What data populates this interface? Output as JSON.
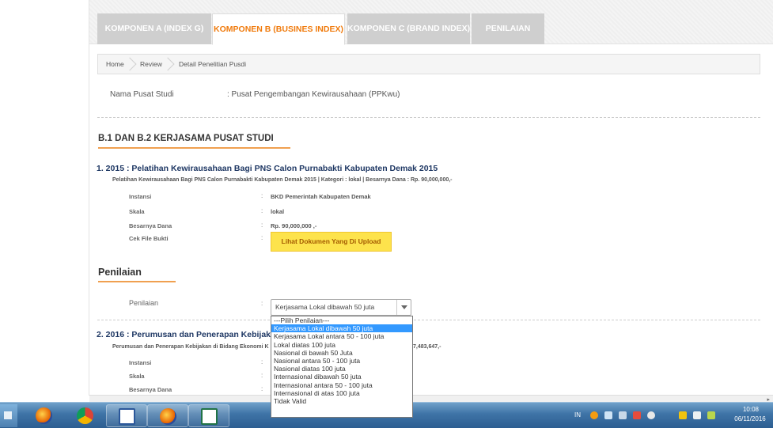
{
  "tabs": [
    {
      "label": "KOMPONEN A (INDEX G)",
      "active": false
    },
    {
      "label": "KOMPONEN B (BUSINES INDEX)",
      "active": true
    },
    {
      "label": "KOMPONEN C (BRAND INDEX)",
      "active": false
    },
    {
      "label": "PENILAIAN",
      "active": false
    }
  ],
  "breadcrumb": [
    "Home",
    "Review",
    "Detail Penelitian Pusdi"
  ],
  "header": {
    "label": "Nama Pusat Studi",
    "value": ": Pusat Pengembangan Kewirausahaan (PPKwu)"
  },
  "section": {
    "title": "B.1 DAN B.2 KERJASAMA PUSAT STUDI"
  },
  "items": [
    {
      "title": "1. 2015 : Pelatihan Kewirausahaan Bagi PNS Calon Purnabakti Kabupaten Demak 2015",
      "subtitle": "Pelatihan Kewirausahaan Bagi PNS Calon Purnabakti Kabupaten Demak 2015 | Kategori : lokal | Besarnya Dana : Rp. 90,000,000,-",
      "fields": [
        {
          "label": "Instansi",
          "value": "BKD Pemerintah Kabupaten Demak"
        },
        {
          "label": "Skala",
          "value": "lokal"
        },
        {
          "label": "Besarnya Dana",
          "value": "Rp. 90,000,000 ,-"
        },
        {
          "label": "Cek File Bukti",
          "value": ""
        }
      ],
      "button": "Lihat Dokumen Yang Di Upload"
    },
    {
      "title_visible": "2. 2016 : Perumusan dan Penerapan Kebijakan di B",
      "subtitle_left": "Perumusan dan Penerapan Kebijakan di Bidang Ekonomi K",
      "subtitle_right": "7,483,647,-",
      "fields": [
        {
          "label": "Instansi"
        },
        {
          "label": "Skala"
        },
        {
          "label": "Besarnya Dana"
        }
      ]
    }
  ],
  "penilaian": {
    "title": "Penilaian",
    "label": "Penilaian",
    "selected": "Kerjasama Lokal dibawah 50 juta",
    "options": [
      "---Pilih Penilaian---",
      "Kerjasama Lokal dibawah 50 juta",
      "Kerjasama Lokal antara 50 - 100 juta",
      "Lokal diatas 100 juta",
      "Nasional di bawah 50 Juta",
      "Nasional antara 50 - 100 juta",
      "Nasional diatas 100 juta",
      "Internasional dibawah 50 juta",
      "Internasional antara 50 - 100 juta",
      "Internasional di atas 100 juta",
      "Tidak Valid"
    ],
    "highlighted_index": 1
  },
  "taskbar": {
    "lang": "IN",
    "time": "10:08",
    "date": "06/11/2016",
    "apps": [
      "start-button",
      "firefox-icon",
      "chrome-icon",
      "word-icon",
      "firefox-icon",
      "excel-icon"
    ]
  }
}
